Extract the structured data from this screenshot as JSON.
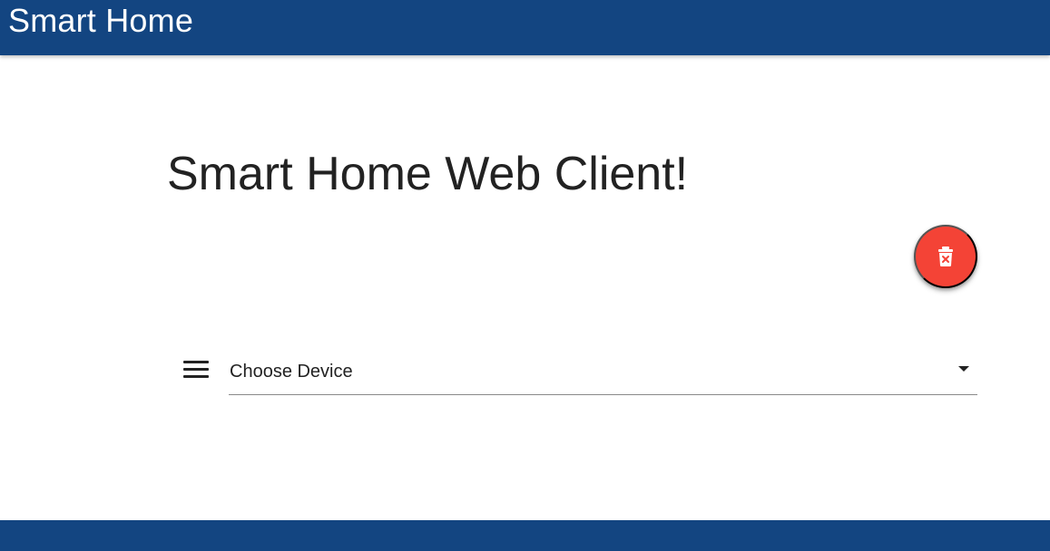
{
  "header": {
    "title": "Smart Home"
  },
  "main": {
    "heading": "Smart Home Web Client!",
    "delete_button": {
      "icon": "trash-x-icon",
      "color": "#f44336"
    },
    "device_select": {
      "selected_value": "Choose Device",
      "menu_icon": "menu-icon",
      "dropdown_icon": "chevron-down-icon"
    }
  },
  "footer": {
    "color": "#134581"
  },
  "colors": {
    "brand": "#134581",
    "accent": "#f44336",
    "text": "#222222"
  }
}
